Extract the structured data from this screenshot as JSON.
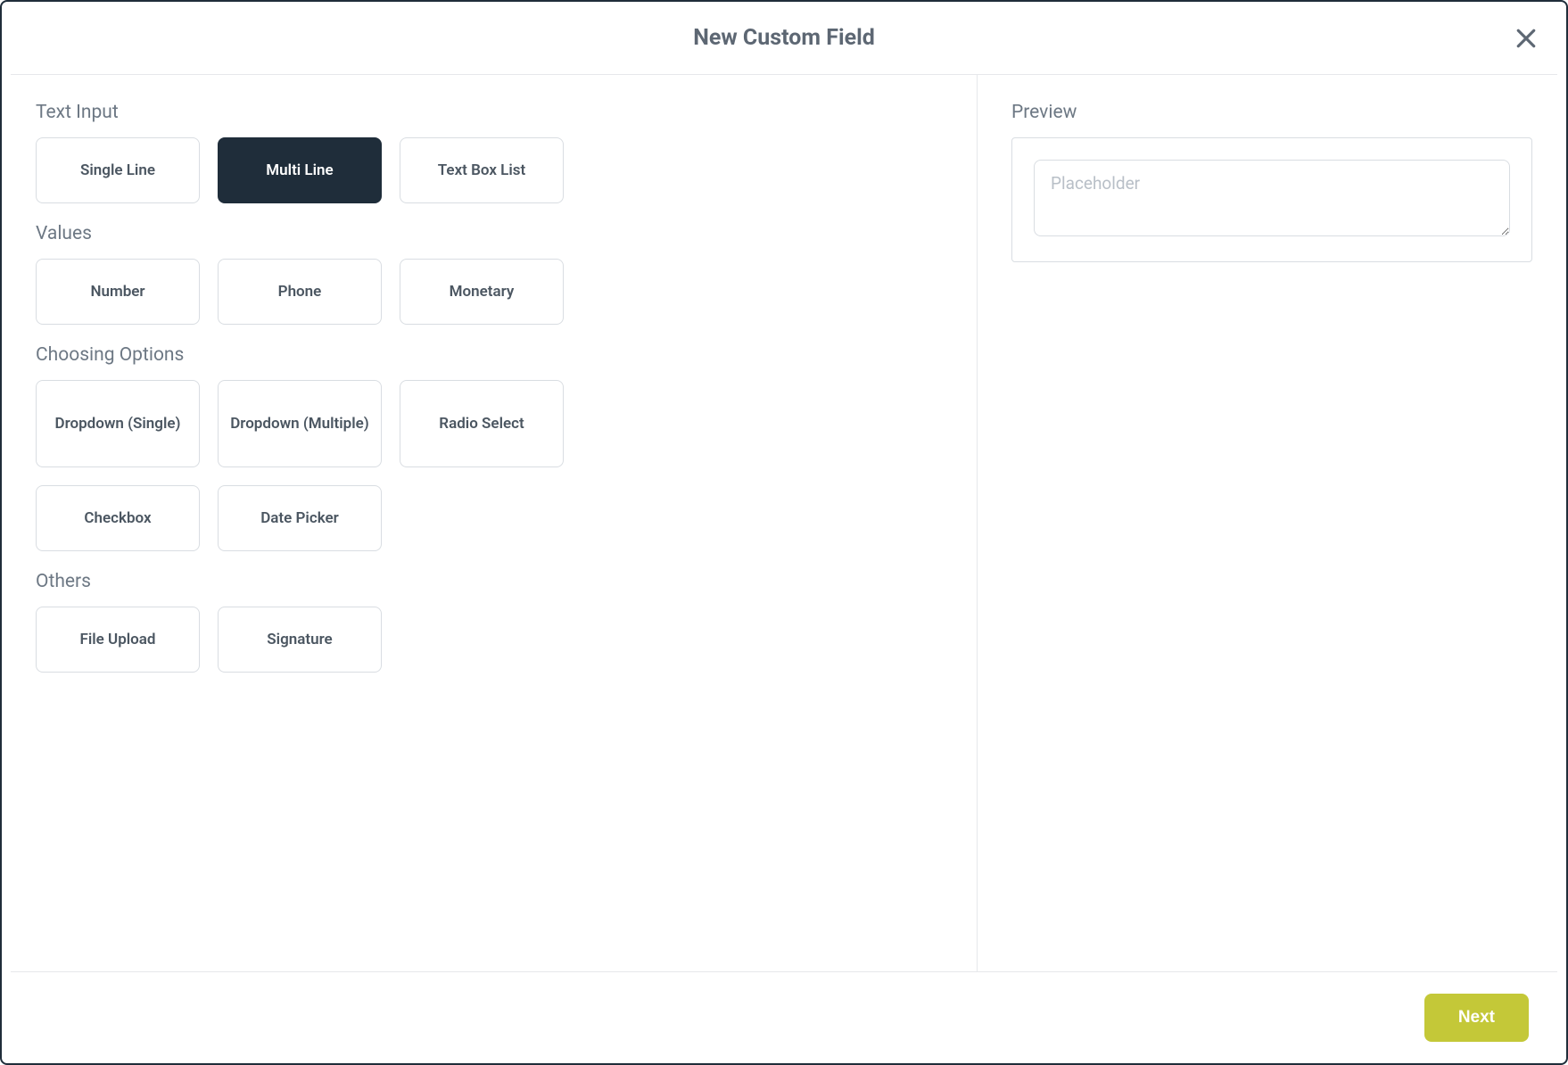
{
  "header": {
    "title": "New Custom Field"
  },
  "sections": {
    "text_input": {
      "label": "Text Input",
      "single_line": "Single Line",
      "multi_line": "Multi Line",
      "text_box_list": "Text Box List"
    },
    "values": {
      "label": "Values",
      "number": "Number",
      "phone": "Phone",
      "monetary": "Monetary"
    },
    "choosing": {
      "label": "Choosing Options",
      "dropdown_single": "Dropdown (Single)",
      "dropdown_multiple": "Dropdown (Multiple)",
      "radio_select": "Radio Select",
      "checkbox": "Checkbox",
      "date_picker": "Date Picker"
    },
    "others": {
      "label": "Others",
      "file_upload": "File Upload",
      "signature": "Signature"
    }
  },
  "preview": {
    "label": "Preview",
    "placeholder": "Placeholder"
  },
  "footer": {
    "next": "Next"
  },
  "selected_field": "multi_line"
}
